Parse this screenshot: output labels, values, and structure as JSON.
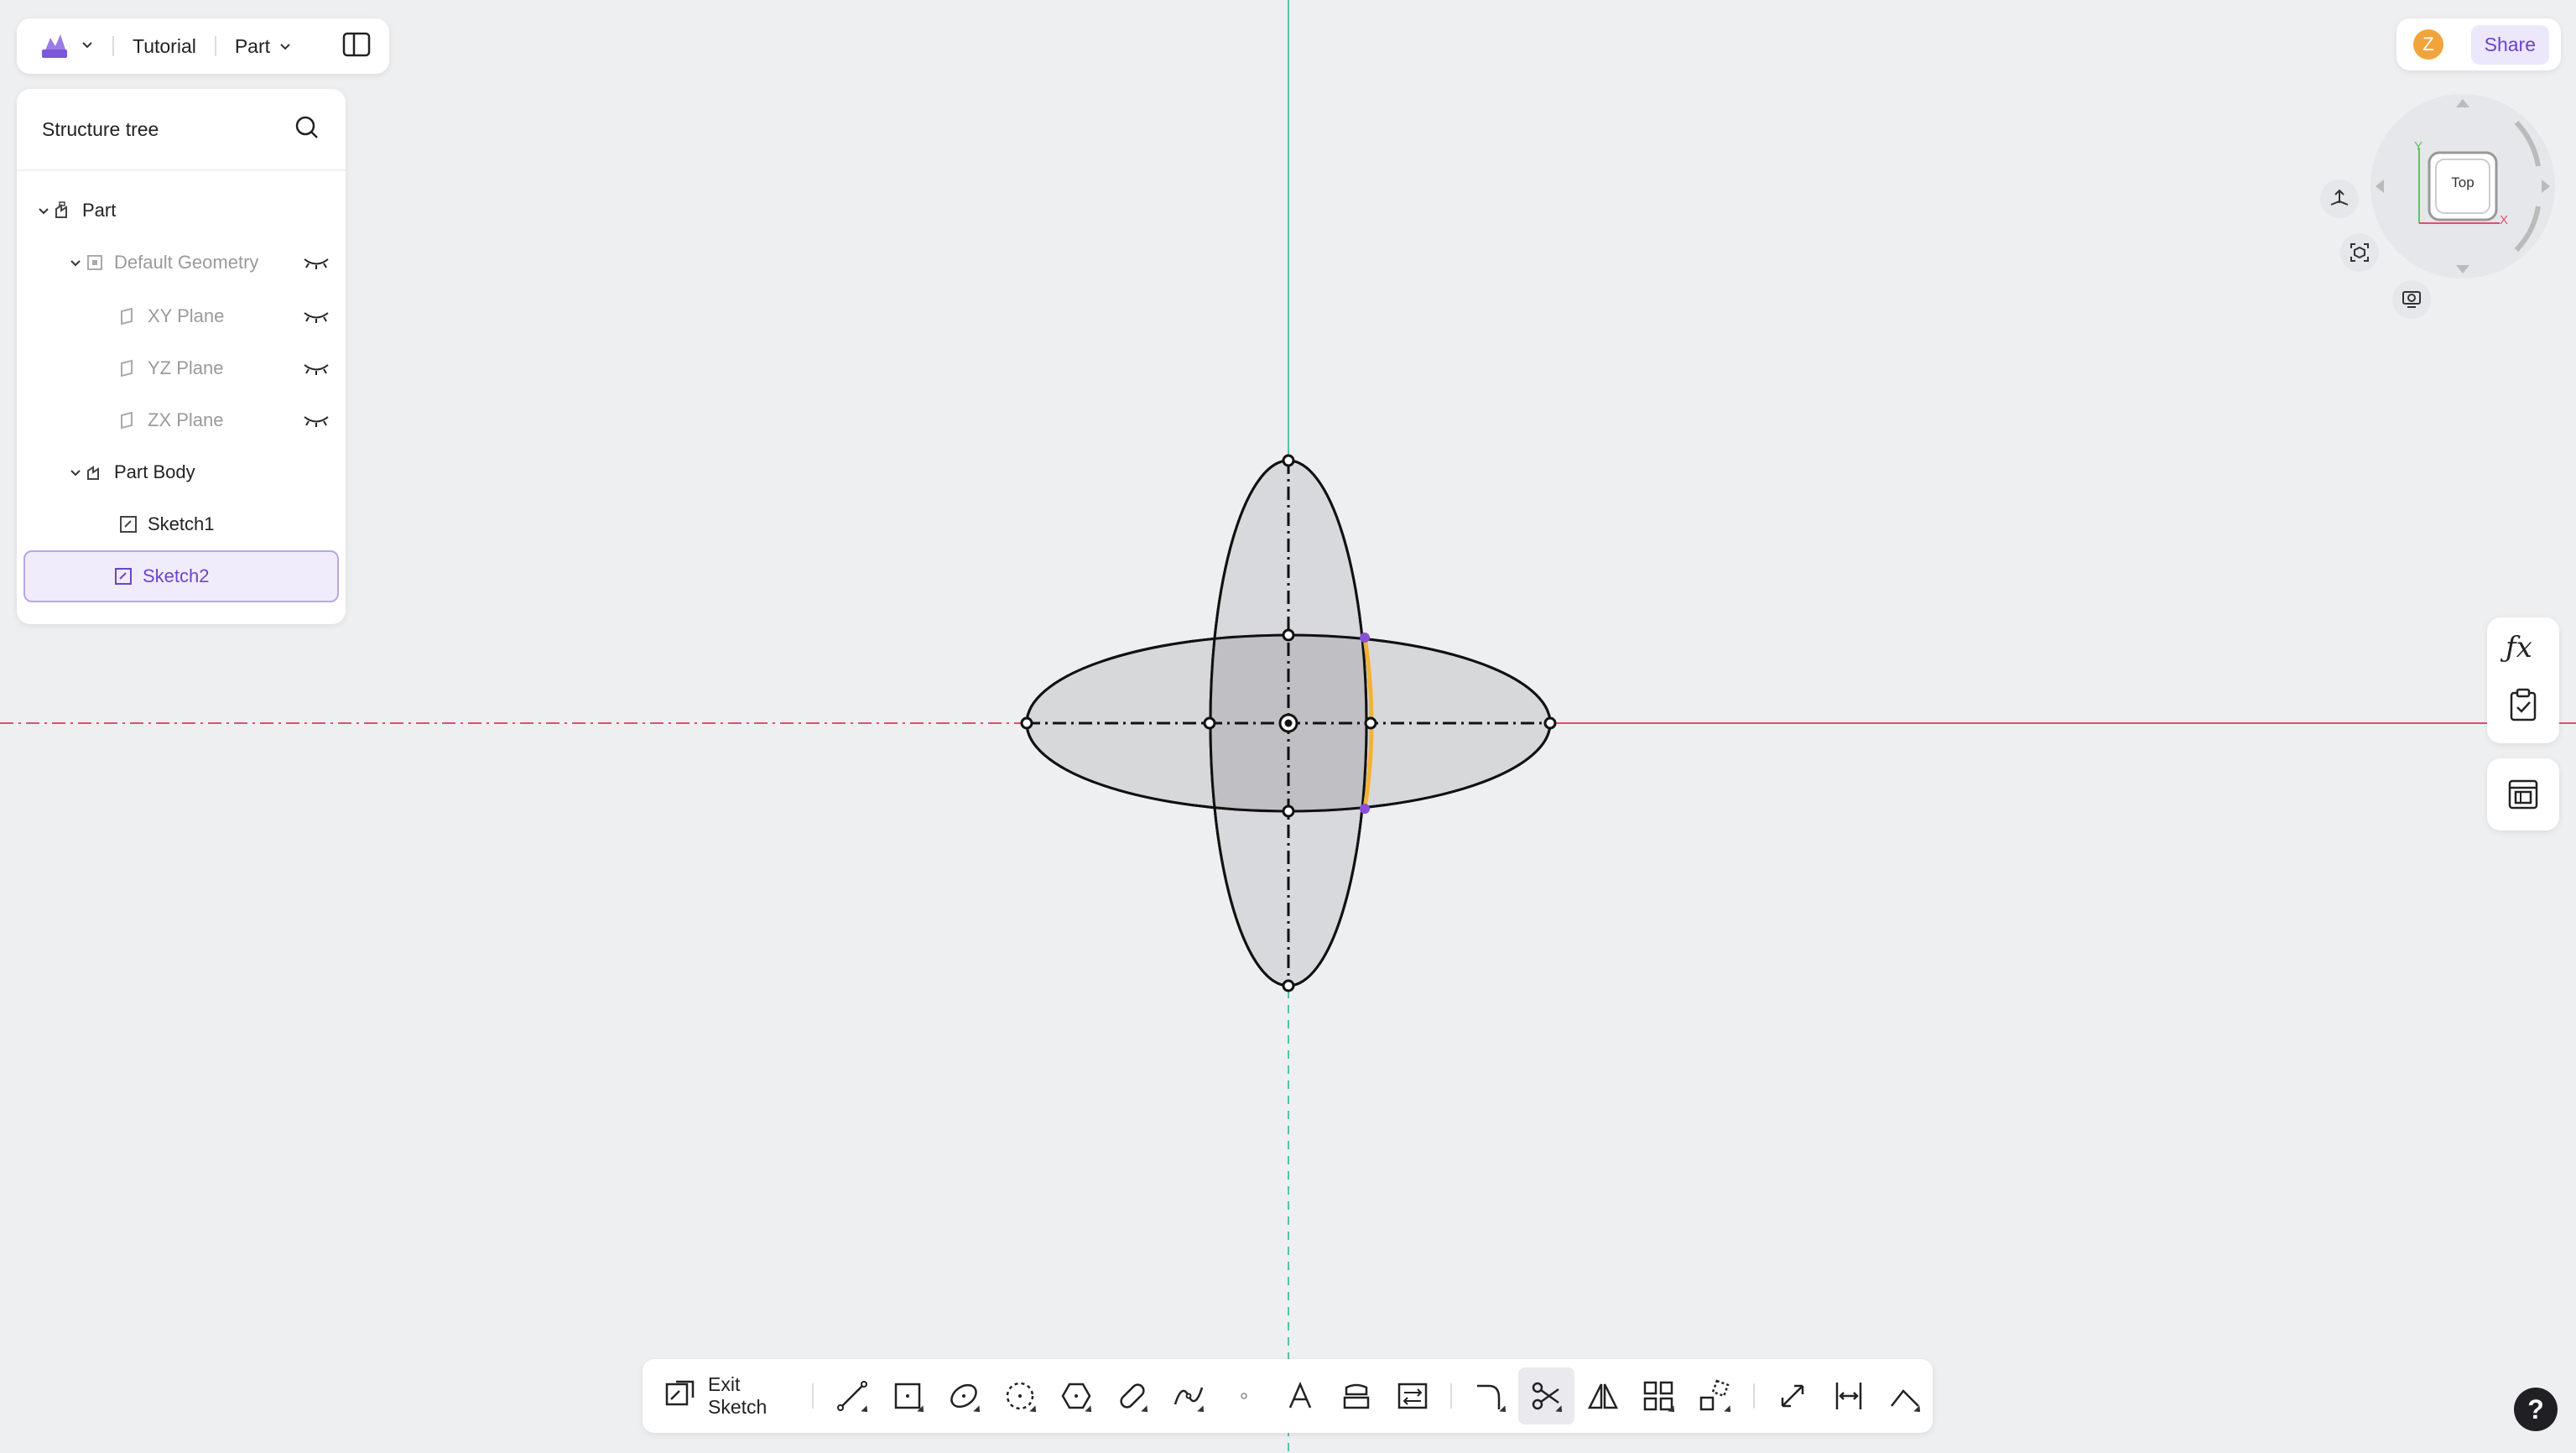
{
  "topbar": {
    "document_name": "Tutorial",
    "mode": "Part"
  },
  "tree": {
    "title": "Structure tree",
    "items": [
      {
        "label": "Part"
      },
      {
        "label": "Default Geometry"
      },
      {
        "label": "XY Plane"
      },
      {
        "label": "YZ Plane"
      },
      {
        "label": "ZX Plane"
      },
      {
        "label": "Part Body"
      },
      {
        "label": "Sketch1"
      },
      {
        "label": "Sketch2"
      }
    ]
  },
  "user": {
    "initial": "Z"
  },
  "share_label": "Share",
  "viewcube": {
    "face": "Top",
    "axis_y": "Y",
    "axis_x": "X"
  },
  "toolbar": {
    "exit_label": "Exit Sketch"
  },
  "help_label": "?",
  "icons": {
    "app_logo": "app-logo-icon",
    "search": "search-icon",
    "eye_hidden": "eye-closed-icon",
    "function": "fx-icon",
    "checklist": "clipboard-check-icon",
    "library": "library-icon"
  },
  "colors": {
    "accent": "#6b45c9",
    "x_axis": "#e0506e",
    "y_axis": "#52c2a8",
    "selected_edge": "#f2b233",
    "point_highlight": "#8a4fd8",
    "fill": "#d2d3d6"
  }
}
